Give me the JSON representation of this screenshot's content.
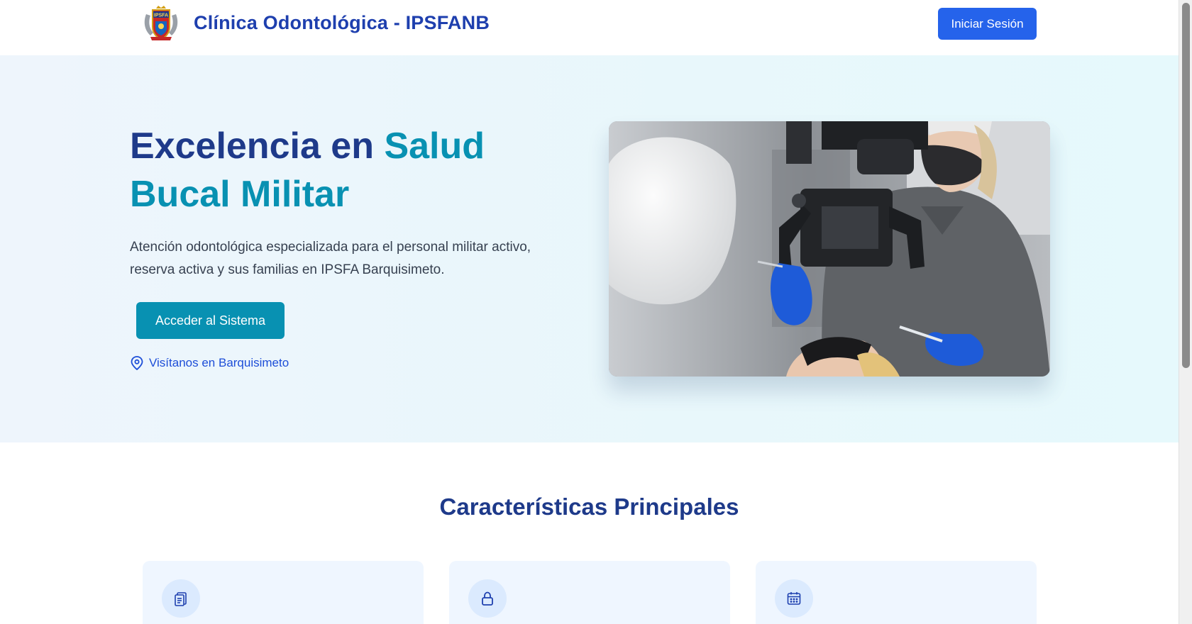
{
  "header": {
    "brand": "Clínica Odontológica - IPSFANB",
    "login_label": "Iniciar Sesión",
    "logo_text": "IPSFA"
  },
  "hero": {
    "title_part1": "Excelencia en ",
    "title_accent": "Salud Bucal Militar",
    "description": "Atención odontológica especializada para el personal militar activo, reserva activa y sus familias en IPSFA Barquisimeto.",
    "cta_label": "Acceder al Sistema",
    "location_label": "Visítanos en Barquisimeto",
    "location_icon": "map-pin-icon"
  },
  "features": {
    "title": "Características Principales",
    "cards": [
      {
        "icon": "clipboard-icon"
      },
      {
        "icon": "lock-icon"
      },
      {
        "icon": "calendar-icon"
      }
    ]
  },
  "colors": {
    "primary": "#1e3a8a",
    "accent": "#0891b2",
    "button_blue": "#2563eb",
    "hero_bg": "#e8f7fb",
    "card_bg": "#eff6ff"
  }
}
